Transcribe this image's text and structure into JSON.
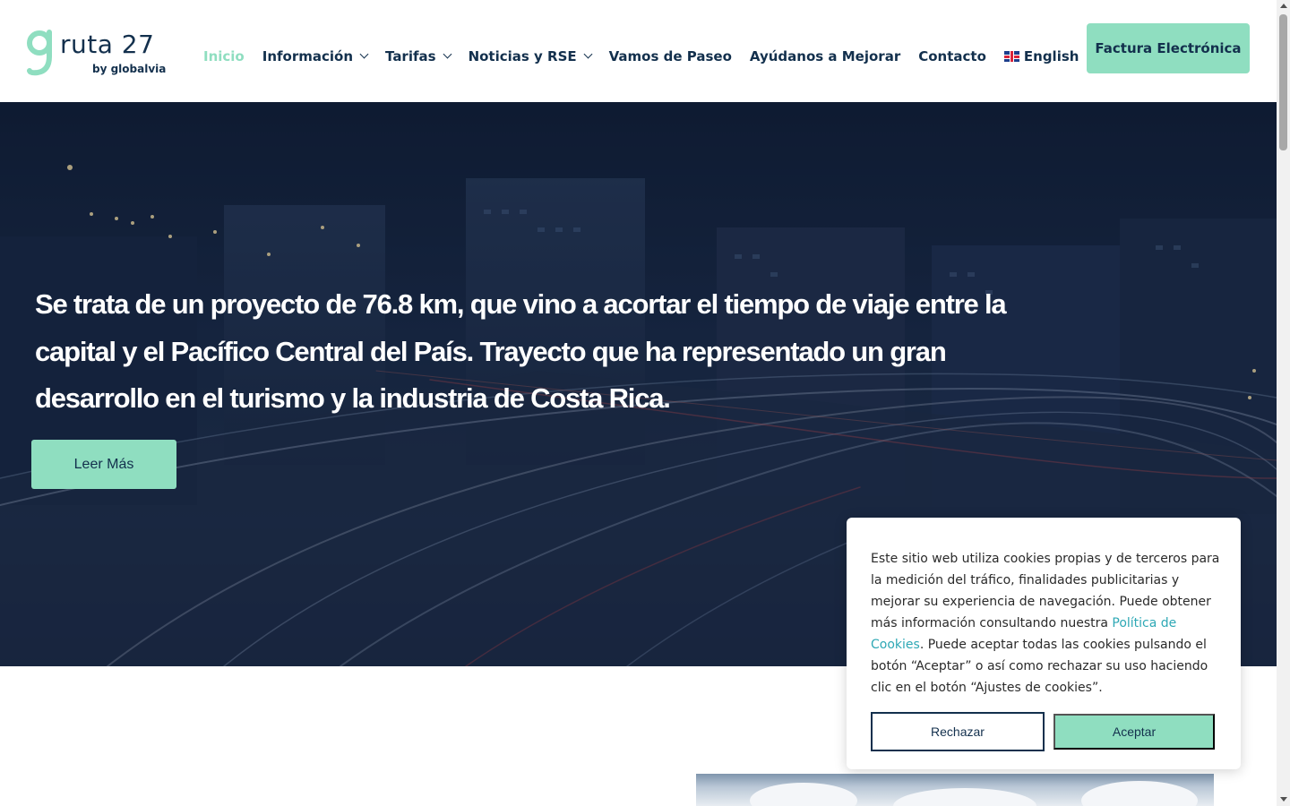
{
  "brand": {
    "name": "ruta 27",
    "byline": "by globalvia",
    "logo_icon": "g-logo-icon",
    "accent_color": "#8fdec0",
    "primary_color": "#13304d"
  },
  "nav": {
    "items": [
      {
        "label": "Inicio",
        "active": true,
        "dropdown": false
      },
      {
        "label": "Información",
        "active": false,
        "dropdown": true
      },
      {
        "label": "Tarifas",
        "active": false,
        "dropdown": true
      },
      {
        "label": "Noticias y RSE",
        "active": false,
        "dropdown": true
      },
      {
        "label": "Vamos de Paseo",
        "active": false,
        "dropdown": false
      },
      {
        "label": "Ayúdanos a Mejorar",
        "active": false,
        "dropdown": false
      },
      {
        "label": "Contacto",
        "active": false,
        "dropdown": false
      },
      {
        "label": "English",
        "active": false,
        "dropdown": false,
        "icon": "uk-flag-icon"
      }
    ],
    "cta_label": "Factura Electrónica"
  },
  "hero": {
    "text": "Se trata de un proyecto de 76.8 km, que vino a acortar el tiempo de viaje entre la capital y el Pacífico Central del País. Trayecto que ha representado un gran desarrollo en el turismo y la industria de Costa Rica.",
    "button_label": "Leer Más"
  },
  "cookie_banner": {
    "text_before_link": "Este sitio web utiliza cookies propias y de terceros para la medición del tráfico, finalidades publicitarias y mejorar su experiencia de navegación. Puede obtener más información consultando nuestra ",
    "link_text": "Política de Cookies",
    "text_after_link": ". Puede aceptar todas las cookies pulsando el botón “Aceptar” o así como rechazar su uso haciendo clic en el botón “Ajustes de cookies”.",
    "reject_label": "Rechazar",
    "accept_label": "Aceptar"
  }
}
